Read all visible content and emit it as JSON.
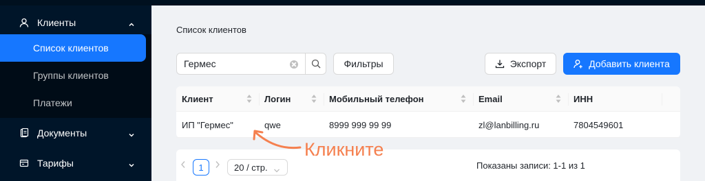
{
  "sidebar": {
    "clients_group": "Клиенты",
    "sub_items": [
      "Список клиентов",
      "Группы клиентов",
      "Платежи"
    ],
    "documents_group": "Документы",
    "tariffs_group": "Тарифы"
  },
  "page": {
    "title": "Список клиентов"
  },
  "search": {
    "value": "Гермес"
  },
  "toolbar": {
    "filters_label": "Фильтры",
    "export_label": "Экспорт",
    "add_label": "Добавить клиента"
  },
  "table": {
    "columns": [
      "Клиент",
      "Логин",
      "Мобильный телефон",
      "Email",
      "ИНН"
    ],
    "rows": [
      [
        "ИП \"Гермес\"",
        "qwe",
        "8999 999 99 99",
        "zl@lanbilling.ru",
        "7804549601"
      ]
    ]
  },
  "annotation": {
    "text": "Кликните"
  },
  "pagination": {
    "current_page": "1",
    "page_size": "20 / стр.",
    "info": "Показаны записи: 1-1 из 1"
  }
}
